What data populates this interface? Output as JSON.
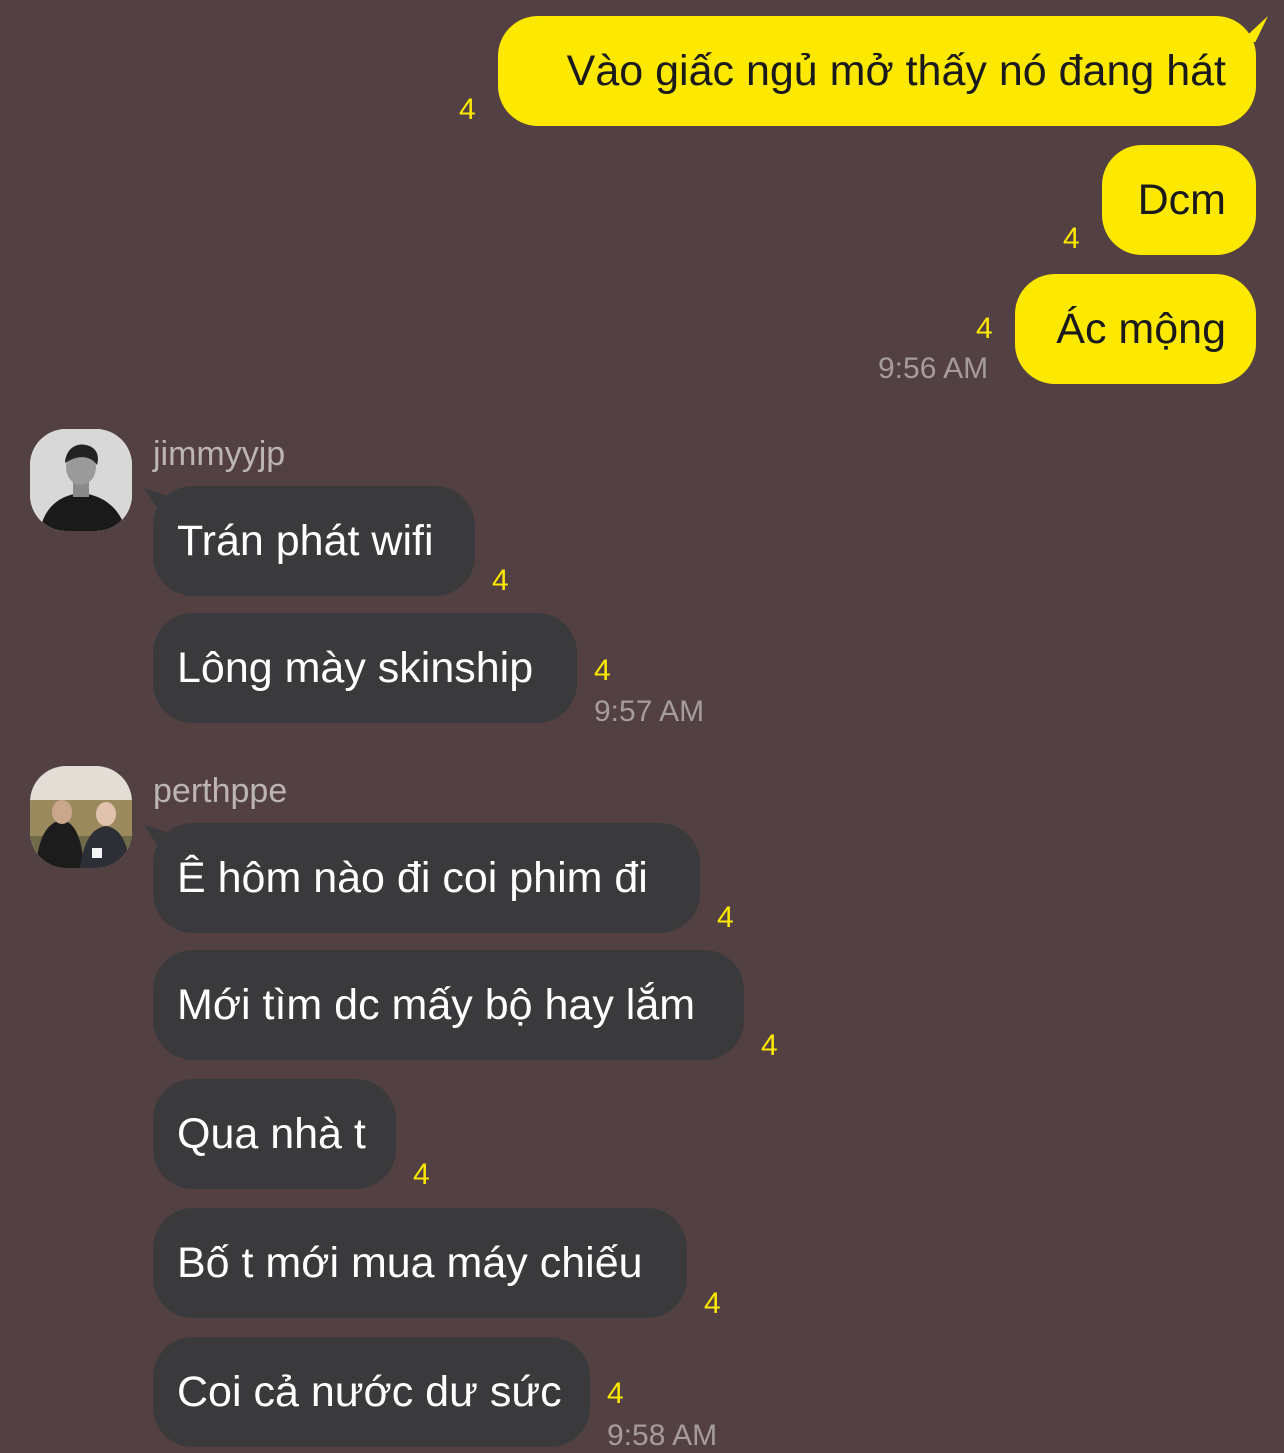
{
  "colors": {
    "background": "#524042",
    "outgoing_bubble": "#fde800",
    "incoming_bubble": "#3a393b",
    "unread_count": "#fde800"
  },
  "outgoing": [
    {
      "text": "Vào giấc ngủ mở thấy nó đang hát",
      "unread": "4"
    },
    {
      "text": "Dcm",
      "unread": "4"
    },
    {
      "text": "Ác mộng",
      "unread": "4",
      "time": "9:56 AM"
    }
  ],
  "groups": [
    {
      "sender": "jimmyyjp",
      "avatar_icon": "profile-photo-man-black-shirt",
      "messages": [
        {
          "text": "Trán phát wifi",
          "unread": "4"
        },
        {
          "text": "Lông mày skinship",
          "unread": "4",
          "time": "9:57 AM"
        }
      ]
    },
    {
      "sender": "perthppe",
      "avatar_icon": "profile-photo-two-people-outdoors",
      "messages": [
        {
          "text": "Ê hôm nào đi coi phim đi",
          "unread": "4"
        },
        {
          "text": "Mới tìm dc mấy bộ hay lắm",
          "unread": "4"
        },
        {
          "text": "Qua nhà t",
          "unread": "4"
        },
        {
          "text": "Bố t mới mua máy chiếu",
          "unread": "4"
        },
        {
          "text": "Coi cả nước dư sức",
          "unread": "4",
          "time": "9:58 AM"
        }
      ]
    }
  ]
}
